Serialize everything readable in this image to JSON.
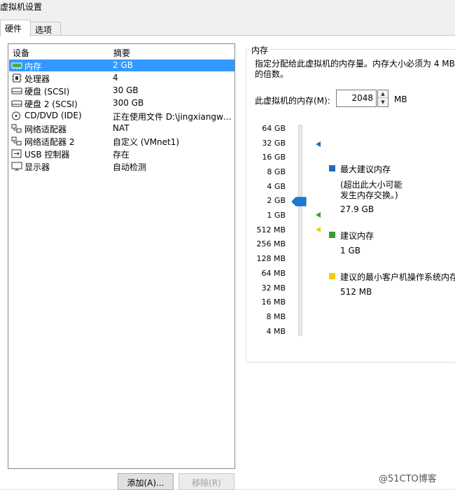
{
  "window": {
    "title": "虚拟机设置"
  },
  "tabs": [
    {
      "label": "硬件"
    },
    {
      "label": "选项"
    }
  ],
  "device_list": {
    "headers": {
      "device": "设备",
      "summary": "摘要"
    },
    "rows": [
      {
        "icon": "memory-icon",
        "name": "内存",
        "summary": "2 GB",
        "selected": true
      },
      {
        "icon": "processor-icon",
        "name": "处理器",
        "summary": "4"
      },
      {
        "icon": "hard-disk-icon",
        "name": "硬盘 (SCSI)",
        "summary": "30 GB"
      },
      {
        "icon": "hard-disk-icon",
        "name": "硬盘 2 (SCSI)",
        "summary": "300 GB"
      },
      {
        "icon": "cd-dvd-icon",
        "name": "CD/DVD (IDE)",
        "summary": "正在使用文件 D:\\jingxiangwe..."
      },
      {
        "icon": "network-adapter-icon",
        "name": "网络适配器",
        "summary": "NAT"
      },
      {
        "icon": "network-adapter-icon",
        "name": "网络适配器 2",
        "summary": "自定义 (VMnet1)"
      },
      {
        "icon": "usb-controller-icon",
        "name": "USB 控制器",
        "summary": "存在"
      },
      {
        "icon": "display-icon",
        "name": "显示器",
        "summary": "自动检测"
      }
    ]
  },
  "buttons": {
    "add": "添加(A)...",
    "remove": "移除(R)"
  },
  "memory": {
    "group_title": "内存",
    "description": "指定分配给此虚拟机的内存量。内存大小必须为 4 MB 的倍数。",
    "field_label": "此虚拟机的内存(M):",
    "value": "2048",
    "unit": "MB",
    "scale_ticks": [
      "64 GB",
      "32 GB",
      "16 GB",
      "8 GB",
      "4 GB",
      "2 GB",
      "1 GB",
      "512 MB",
      "256 MB",
      "128 MB",
      "64 MB",
      "32 MB",
      "16 MB",
      "8 MB",
      "4 MB"
    ],
    "legend": {
      "max": {
        "label": "最大建议内存",
        "note1": "(超出此大小可能",
        "note2": "发生内存交换。)",
        "value": "27.9 GB",
        "color": "#1e6eb4"
      },
      "recommended": {
        "label": "建议内存",
        "value": "1 GB",
        "color": "#3c9a32"
      },
      "min_guest": {
        "label": "建议的最小客户机操作系统内存",
        "value": "512 MB",
        "color": "#f0d000"
      }
    }
  },
  "watermark": "@51CTO博客"
}
